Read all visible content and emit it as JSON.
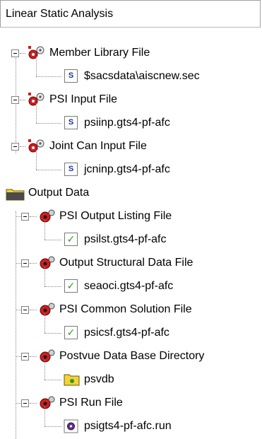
{
  "panel": {
    "title": "Linear Static Analysis"
  },
  "tree": {
    "member_library": {
      "label": "Member Library File",
      "child": "$sacsdata\\aiscnew.sec"
    },
    "psi_input": {
      "label": "PSI Input File",
      "child": "psiinp.gts4-pf-afc"
    },
    "joint_can": {
      "label": "Joint Can Input File",
      "child": "jcninp.gts4-pf-afc"
    },
    "output_data": {
      "label": "Output Data"
    },
    "psi_output_listing": {
      "label": "PSI Output Listing File",
      "child": "psilst.gts4-pf-afc"
    },
    "output_structural": {
      "label": "Output Structural Data File",
      "child": "seaoci.gts4-pf-afc"
    },
    "psi_common_solution": {
      "label": "PSI Common Solution File",
      "child": "psicsf.gts4-pf-afc"
    },
    "postvue_db": {
      "label": "Postvue Data Base Directory",
      "child": "psvdb"
    },
    "psi_run": {
      "label": "PSI Run File",
      "child": "psigts4-pf-afc.run"
    }
  },
  "icons": {
    "input_group": "red-gear-input-icon",
    "output_group": "red-gear-output-icon",
    "input_file": "s-document-icon",
    "output_file": "green-check-document-icon",
    "folder": "yellow-folder-icon",
    "run_file": "gear-document-icon"
  },
  "colors": {
    "check": "#2e9c1e",
    "gear_red": "#cc1f1f",
    "folder": "#f3d23b",
    "s_icon": "#1b2fa0"
  }
}
